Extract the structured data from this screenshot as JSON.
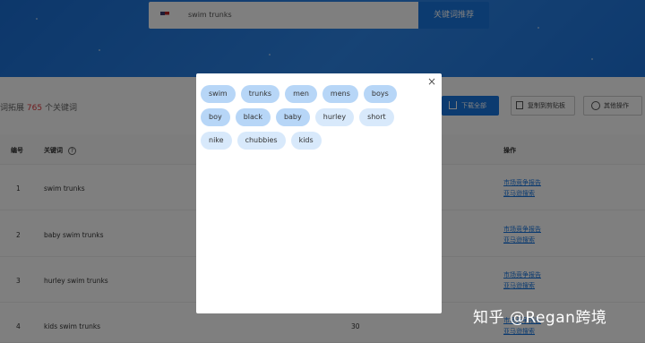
{
  "search": {
    "value": "swim trunks",
    "button_label": "关键词推荐"
  },
  "summary": {
    "prefix": "词拓展",
    "count": "765",
    "suffix": "个关键词"
  },
  "toolbar": {
    "download_label": "下载全部",
    "copy_label": "复制到剪贴板",
    "more_label": "其他操作"
  },
  "table": {
    "headers": {
      "num": "编号",
      "keyword": "关键词",
      "ops": "操作"
    },
    "rows": [
      {
        "num": "1",
        "keyword": "swim trunks",
        "value": "",
        "link1": "市场竞争报告",
        "link2": "亚马逊搜索"
      },
      {
        "num": "2",
        "keyword": "baby swim trunks",
        "value": "",
        "link1": "市场竞争报告",
        "link2": "亚马逊搜索"
      },
      {
        "num": "3",
        "keyword": "hurley swim trunks",
        "value": "",
        "link1": "市场竞争报告",
        "link2": "亚马逊搜索"
      },
      {
        "num": "4",
        "keyword": "kids swim trunks",
        "value": "30",
        "link1": "市场竞争报告",
        "link2": "亚马逊搜索"
      }
    ]
  },
  "modal": {
    "close": "×",
    "tags": [
      {
        "label": "swim",
        "style": "a"
      },
      {
        "label": "trunks",
        "style": "a"
      },
      {
        "label": "men",
        "style": "a"
      },
      {
        "label": "mens",
        "style": "a"
      },
      {
        "label": "boys",
        "style": "a"
      },
      {
        "label": "boy",
        "style": "a"
      },
      {
        "label": "black",
        "style": "a"
      },
      {
        "label": "baby",
        "style": "a"
      },
      {
        "label": "hurley",
        "style": "b"
      },
      {
        "label": "short",
        "style": "b"
      },
      {
        "label": "nike",
        "style": "b"
      },
      {
        "label": "chubbies",
        "style": "b"
      },
      {
        "label": "kids",
        "style": "b"
      }
    ]
  },
  "watermark": "知乎 @Regan跨境"
}
